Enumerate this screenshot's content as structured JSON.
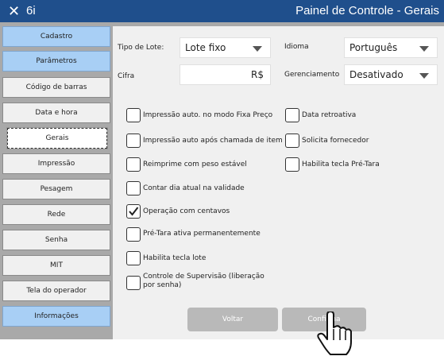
{
  "titlebar": {
    "close_glyph": "✕",
    "app_name": "6i",
    "title": "Painel de Controle - Gerais"
  },
  "sidebar": {
    "items": [
      {
        "label": "Cadastro",
        "state": "highlight"
      },
      {
        "label": "Parâmetros",
        "state": "highlight"
      },
      {
        "label": "Código de barras",
        "state": "normal"
      },
      {
        "label": "Data e hora",
        "state": "normal"
      },
      {
        "label": "Gerais",
        "state": "selected"
      },
      {
        "label": "Impressão",
        "state": "normal"
      },
      {
        "label": "Pesagem",
        "state": "normal"
      },
      {
        "label": "Rede",
        "state": "normal"
      },
      {
        "label": "Senha",
        "state": "normal"
      },
      {
        "label": "MIT",
        "state": "normal"
      },
      {
        "label": "Tela do operador",
        "state": "normal"
      },
      {
        "label": "Informações",
        "state": "highlight"
      }
    ]
  },
  "form": {
    "tipo_lote_label": "Tipo de Lote:",
    "tipo_lote_value": "Lote fixo",
    "idioma_label": "Idioma",
    "idioma_value": "Português",
    "cifra_label": "Cifra",
    "cifra_value": "R$",
    "gerenciamento_label": "Gerenciamento",
    "gerenciamento_value": "Desativado"
  },
  "options_left": [
    {
      "label": "Impressão auto. no modo Fixa Preço",
      "checked": false
    },
    {
      "label": "Impressão auto após chamada de item",
      "checked": false
    },
    {
      "label": "Reimprime com peso estável",
      "checked": false
    },
    {
      "label": "Contar dia atual na validade",
      "checked": false
    },
    {
      "label": "Operação com centavos",
      "checked": true
    },
    {
      "label": "Pré-Tara ativa permanentemente",
      "checked": false
    },
    {
      "label": "Habilita tecla lote",
      "checked": false
    },
    {
      "label": "Controle de Supervisão (liberação por senha)",
      "checked": false
    }
  ],
  "options_right": [
    {
      "label": "Data retroativa",
      "checked": false
    },
    {
      "label": "Solicita fornecedor",
      "checked": false
    },
    {
      "label": "Habilita tecla Pré-Tara",
      "checked": false
    }
  ],
  "buttons": {
    "back": "Voltar",
    "confirm": "Confirma"
  },
  "colors": {
    "titlebar": "#1f4f8c",
    "highlight": "#a8cff5",
    "panel": "#f0f0f0",
    "button": "#b9b9b9"
  },
  "icons": {
    "close": "close-icon",
    "dropdown": "chevron-down-icon",
    "check": "checkmark-icon",
    "cursor": "hand-pointer-icon"
  }
}
